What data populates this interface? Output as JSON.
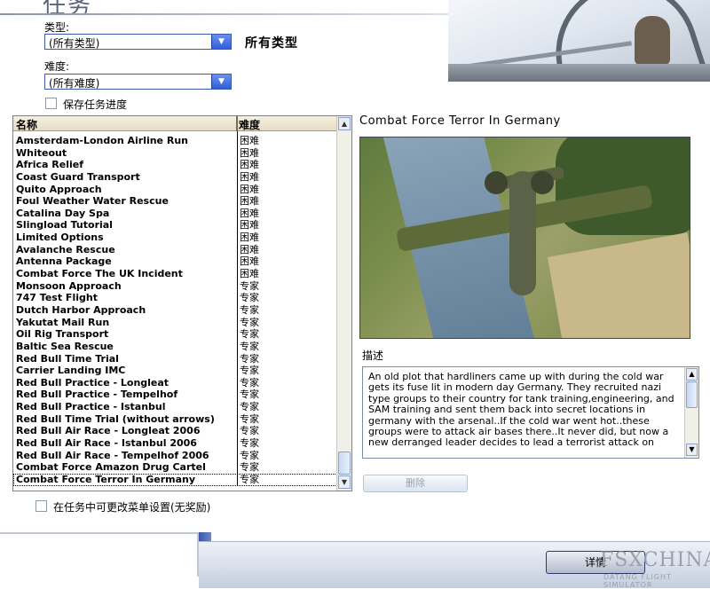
{
  "header": {
    "title": "任务"
  },
  "filters": {
    "type_label": "类型:",
    "type_value": "(所有类型)",
    "type_display": "所有类型",
    "difficulty_label": "难度:",
    "difficulty_value": "(所有难度)",
    "save_progress_label": "保存任务进度"
  },
  "mission_list": {
    "columns": [
      "名称",
      "难度"
    ],
    "rows": [
      {
        "name": "Amsterdam-London Airline Run",
        "difficulty": "困难"
      },
      {
        "name": "Whiteout",
        "difficulty": "困难"
      },
      {
        "name": "Africa Relief",
        "difficulty": "困难"
      },
      {
        "name": "Coast Guard Transport",
        "difficulty": "困难"
      },
      {
        "name": "Quito Approach",
        "difficulty": "困难"
      },
      {
        "name": "Foul Weather Water Rescue",
        "difficulty": "困难"
      },
      {
        "name": "Catalina Day Spa",
        "difficulty": "困难"
      },
      {
        "name": "Slingload Tutorial",
        "difficulty": "困难"
      },
      {
        "name": "Limited Options",
        "difficulty": "困难"
      },
      {
        "name": "Avalanche Rescue",
        "difficulty": "困难"
      },
      {
        "name": "Antenna Package",
        "difficulty": "困难"
      },
      {
        "name": "Combat Force The UK Incident",
        "difficulty": "困难"
      },
      {
        "name": "Monsoon Approach",
        "difficulty": "专家"
      },
      {
        "name": "747 Test Flight",
        "difficulty": "专家"
      },
      {
        "name": "Dutch Harbor Approach",
        "difficulty": "专家"
      },
      {
        "name": "Yakutat Mail Run",
        "difficulty": "专家"
      },
      {
        "name": "Oil Rig Transport",
        "difficulty": "专家"
      },
      {
        "name": "Baltic Sea Rescue",
        "difficulty": "专家"
      },
      {
        "name": "Red Bull Time Trial",
        "difficulty": "专家"
      },
      {
        "name": "Carrier Landing IMC",
        "difficulty": "专家"
      },
      {
        "name": "Red Bull Practice - Longleat",
        "difficulty": "专家"
      },
      {
        "name": "Red Bull Practice - Tempelhof",
        "difficulty": "专家"
      },
      {
        "name": "Red Bull Practice - Istanbul",
        "difficulty": "专家"
      },
      {
        "name": "Red Bull Time Trial (without arrows)",
        "difficulty": "专家"
      },
      {
        "name": "Red Bull Air Race - Longleat 2006",
        "difficulty": "专家"
      },
      {
        "name": "Red Bull Air Race - Istanbul 2006",
        "difficulty": "专家"
      },
      {
        "name": "Red Bull Air Race - Tempelhof 2006",
        "difficulty": "专家"
      },
      {
        "name": "Combat Force Amazon Drug Cartel",
        "difficulty": "专家"
      },
      {
        "name": "Combat Force Terror In Germany",
        "difficulty": "专家",
        "selected": true
      }
    ]
  },
  "detail": {
    "mission_title": "Combat Force Terror In Germany",
    "description_label": "描述",
    "description": "An old plot that hardliners came up with during the cold war gets its fuse lit in modern day Germany. They recruited nazi type groups to their country for tank training,engineering, and SAM training and sent them back into secret locations in germany with the arsenal..If the cold war went hot..these groups were to attack air bases there..It never did, but now a new  derranged leader decides to lead a terrorist attack on",
    "delete_label": "删除"
  },
  "options": {
    "allow_menu_change_label": "在任务中可更改菜单设置(无奖励)"
  },
  "footer": {
    "details_label": "详情",
    "watermark_main": "FSXCHINA",
    "watermark_sub": "DATANG FLIGHT SIMULATOR"
  }
}
